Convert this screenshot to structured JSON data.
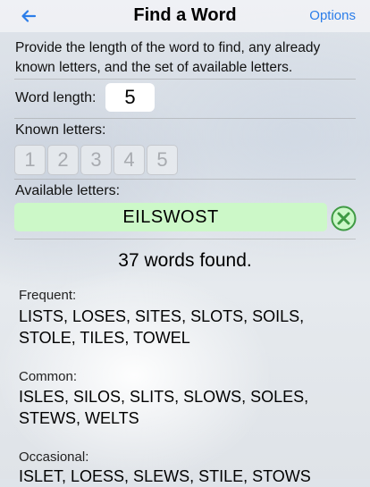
{
  "header": {
    "title": "Find a Word",
    "options_label": "Options",
    "back_icon": "left-arrow-icon",
    "accent_color": "#2b7de9"
  },
  "intro": "Provide the length of the word to find, any already known letters, and the set of available letters.",
  "word_length": {
    "label": "Word length:",
    "value": "5"
  },
  "known_letters": {
    "label": "Known letters:",
    "slots": [
      "1",
      "2",
      "3",
      "4",
      "5"
    ]
  },
  "available_letters": {
    "label": "Available letters:",
    "value": "EILSWOST",
    "field_color": "#ccf8c8",
    "clear_icon": "clear-x-circle-icon"
  },
  "result_count": "37 words found.",
  "groups": [
    {
      "label": "Frequent:",
      "words": "LISTS, LOSES, SITES, SLOTS, SOILS, STOLE, TILES, TOWEL"
    },
    {
      "label": "Common:",
      "words": "ISLES, SILOS, SLITS, SLOWS, SOLES, STEWS, WELTS"
    },
    {
      "label": "Occasional:",
      "words": "ISLET, LOESS, SLEWS, STILE, STOWS"
    }
  ]
}
